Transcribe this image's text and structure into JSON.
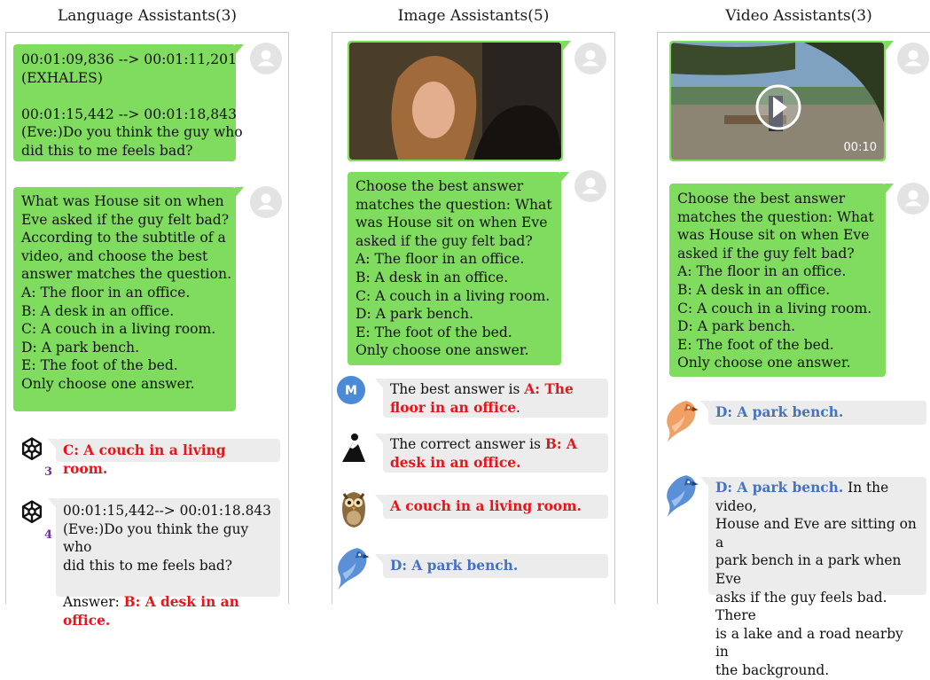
{
  "panels": {
    "language": {
      "title": "Language Assistants(3)",
      "subtitle_bubble": [
        "00:01:09,836 --> 00:01:11,201",
        "(EXHALES)",
        "",
        "00:01:15,442 --> 00:01:18,843",
        "(Eve:)Do you think the guy who",
        "did this to me feels bad?"
      ],
      "question_bubble": [
        "What was House sit on when",
        "Eve asked if the guy felt bad?",
        "According to the subtitle of a",
        "video, and choose the best",
        "answer matches the question.",
        "A: The floor in an office.",
        "B: A desk in an office.",
        "C: A couch in a living room.",
        "D: A park bench.",
        "E: The foot of the bed.",
        "Only choose one answer."
      ],
      "answers": [
        {
          "badge": "3",
          "icon": "openai-logo-icon",
          "text": "C: A couch in a living room."
        },
        {
          "badge": "4",
          "icon": "openai-logo-icon",
          "lines": [
            "00:01:15,442--> 00:01:18.843",
            "(Eve:)Do you think the guy who",
            "did this to me feels bad?",
            ""
          ],
          "answer_prefix": "Answer: ",
          "answer_text": "B: A desk in an office."
        }
      ]
    },
    "image": {
      "title": "Image Assistants(5)",
      "question_bubble": [
        "Choose the best answer",
        "matches the question: What",
        "was House sit on when Eve",
        "asked if the guy felt bad?",
        "A: The floor in an office.",
        "B: A desk in an office.",
        "C: A couch in a living room.",
        "D: A park bench.",
        "E: The foot of the bed.",
        "Only choose one answer."
      ],
      "answers": [
        {
          "icon": "m-badge-icon",
          "badge_letter": "M",
          "prefix": "The best answer is ",
          "highlight": "A: The floor in an office",
          "suffix": "."
        },
        {
          "icon": "mountain-logo-icon",
          "prefix": "The correct answer is ",
          "highlight": "B: A desk in an office.",
          "suffix": ""
        },
        {
          "icon": "owl-icon",
          "prefix": "",
          "highlight": "A couch in a living room.",
          "suffix": ""
        },
        {
          "icon": "blue-parrot-icon",
          "prefix": "",
          "highlight": "D: A park bench.",
          "suffix": ""
        }
      ]
    },
    "video": {
      "title": "Video Assistants(3)",
      "duration": "00:10",
      "question_bubble": [
        "Choose the best answer",
        "matches the question: What",
        "was House sit on when Eve",
        "asked if the guy felt bad?",
        "A: The floor in an office.",
        "B: A desk in an office.",
        "C: A couch in a living room.",
        "D: A park bench.",
        "E: The foot of the bed.",
        "Only choose one answer."
      ],
      "answers": [
        {
          "icon": "orange-parrot-icon",
          "highlight": "D: A park bench.",
          "rest": []
        },
        {
          "icon": "blue-parrot-icon",
          "highlight": "D: A park bench.",
          "first_line_rest": " In the video,",
          "rest": [
            "House and Eve are sitting on a",
            "park bench in a park when Eve",
            "asks if the guy feels bad. There",
            "is a lake and a road nearby in",
            "the background."
          ]
        }
      ]
    }
  },
  "colors": {
    "user_bubble": "#7fdc5e",
    "assistant_bubble": "#ececec",
    "wrong_answer": "#e8141a",
    "correct_answer": "#4472c4",
    "gpt_badge": "#7030a0"
  }
}
